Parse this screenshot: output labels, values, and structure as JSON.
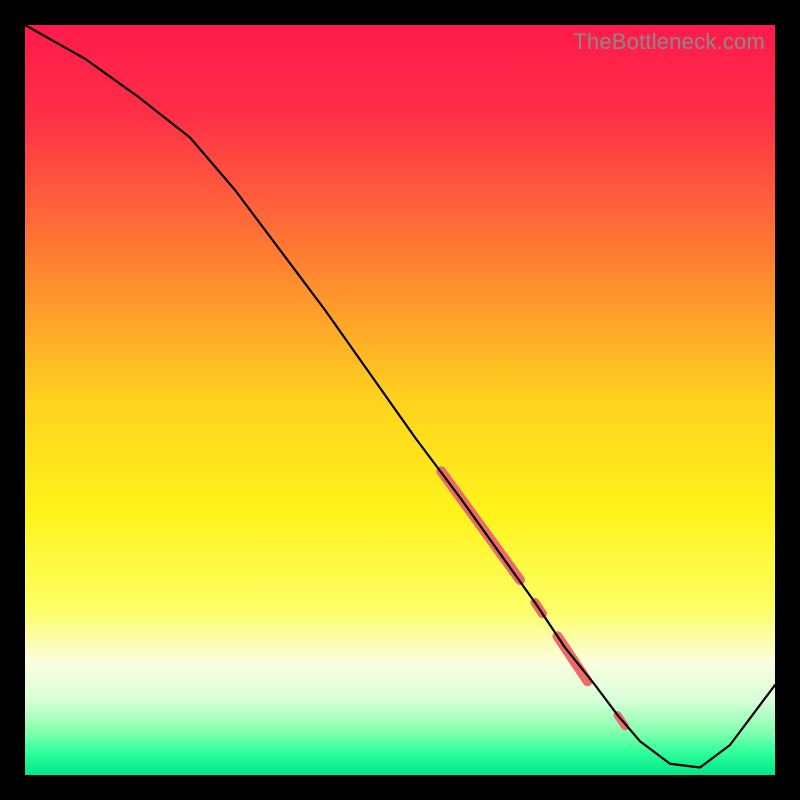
{
  "watermark": "TheBottleneck.com",
  "chart_data": {
    "type": "line",
    "title": "",
    "xlabel": "",
    "ylabel": "",
    "xlim": [
      0,
      100
    ],
    "ylim": [
      0,
      100
    ],
    "gradient_stops": [
      {
        "pos": 0.0,
        "color": "#ff1a4b"
      },
      {
        "pos": 0.12,
        "color": "#ff2f47"
      },
      {
        "pos": 0.3,
        "color": "#ff7a33"
      },
      {
        "pos": 0.5,
        "color": "#ffd21e"
      },
      {
        "pos": 0.65,
        "color": "#fff31a"
      },
      {
        "pos": 0.78,
        "color": "#fdff66"
      },
      {
        "pos": 0.85,
        "color": "#fafde0"
      },
      {
        "pos": 0.9,
        "color": "#d8ffd8"
      },
      {
        "pos": 0.94,
        "color": "#8affb0"
      },
      {
        "pos": 0.97,
        "color": "#2fff9a"
      },
      {
        "pos": 1.0,
        "color": "#00e58a"
      }
    ],
    "series": [
      {
        "name": "curve",
        "x": [
          0.0,
          8.0,
          15.0,
          22.0,
          28.0,
          34.0,
          40.0,
          46.0,
          52.0,
          58.0,
          63.0,
          68.0,
          72.0,
          76.0,
          79.0,
          82.0,
          86.0,
          90.0,
          94.0,
          100.0
        ],
        "y": [
          100.0,
          95.5,
          90.5,
          85.0,
          78.0,
          70.0,
          62.0,
          53.5,
          45.0,
          37.0,
          30.0,
          23.0,
          17.0,
          12.0,
          8.0,
          4.5,
          1.5,
          1.0,
          4.0,
          12.0
        ]
      }
    ],
    "highlight_segments": [
      {
        "x0": 55.5,
        "y0": 40.5,
        "x1": 66.0,
        "y1": 26.0,
        "width": 10
      },
      {
        "x0": 68.0,
        "y0": 23.0,
        "x1": 69.0,
        "y1": 21.5,
        "width": 9
      },
      {
        "x0": 71.0,
        "y0": 18.5,
        "x1": 75.0,
        "y1": 12.5,
        "width": 10
      },
      {
        "x0": 79.0,
        "y0": 8.0,
        "x1": 80.0,
        "y1": 6.5,
        "width": 8
      }
    ]
  }
}
